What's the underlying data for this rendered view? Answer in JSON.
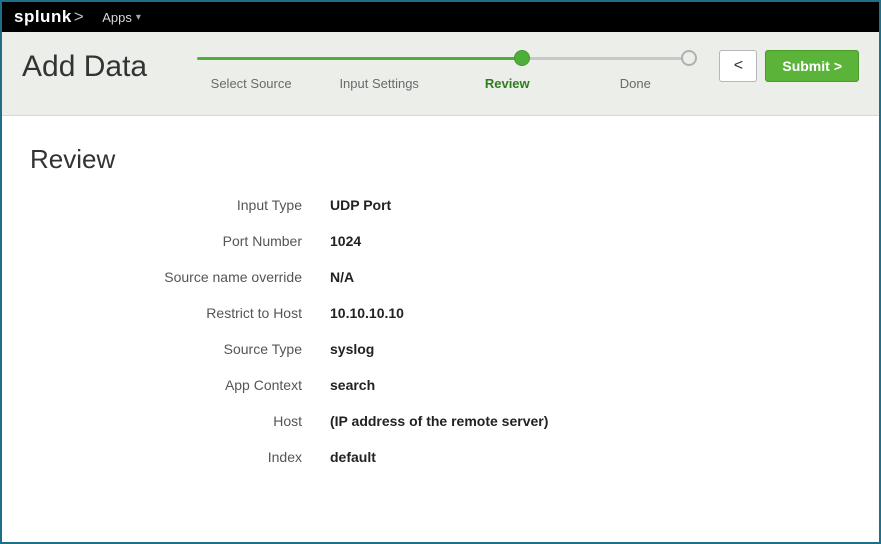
{
  "brand": {
    "name": "splunk",
    "suffix": ">"
  },
  "topnav": {
    "apps_label": "Apps"
  },
  "header": {
    "title": "Add Data",
    "steps": [
      {
        "label": "Select Source",
        "state": "done"
      },
      {
        "label": "Input Settings",
        "state": "done"
      },
      {
        "label": "Review",
        "state": "current"
      },
      {
        "label": "Done",
        "state": "future"
      }
    ],
    "back_glyph": "<",
    "submit_label": "Submit"
  },
  "review": {
    "title": "Review",
    "rows": [
      {
        "label": "Input Type",
        "value": "UDP Port"
      },
      {
        "label": "Port Number",
        "value": "1024"
      },
      {
        "label": "Source name override",
        "value": "N/A"
      },
      {
        "label": "Restrict to Host",
        "value": "10.10.10.10"
      },
      {
        "label": "Source Type",
        "value": "syslog"
      },
      {
        "label": "App Context",
        "value": "search"
      },
      {
        "label": "Host",
        "value": "(IP address of the remote server)"
      },
      {
        "label": "Index",
        "value": "default"
      }
    ]
  }
}
